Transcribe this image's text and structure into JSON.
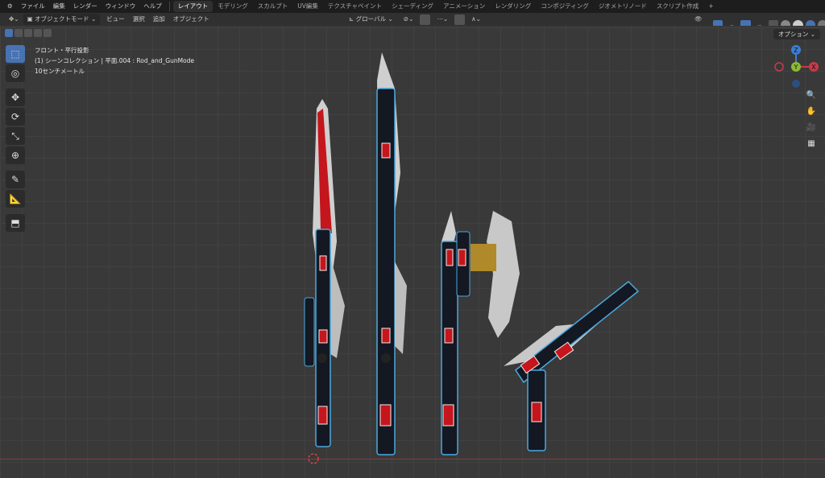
{
  "topbar": {
    "menus": [
      "ファイル",
      "編集",
      "レンダー",
      "ウィンドウ",
      "ヘルプ"
    ],
    "workspaces": [
      "レイアウト",
      "モデリング",
      "スカルプト",
      "UV編集",
      "テクスチャペイント",
      "シェーディング",
      "アニメーション",
      "レンダリング",
      "コンポジティング",
      "ジオメトリノード",
      "スクリプト作成"
    ],
    "active_workspace": "レイアウト",
    "add_tab": "+"
  },
  "header": {
    "mode": "オブジェクトモード",
    "menus": [
      "ビュー",
      "選択",
      "追加",
      "オブジェクト"
    ],
    "transform_orientation": "グローバル"
  },
  "viewport": {
    "view_name": "フロント・平行投影",
    "collection_info": "(1) シーンコレクション | 平面.004 : Rod_and_GunMode",
    "scale": "10センチメートル",
    "options_label": "オプション"
  },
  "gizmo": {
    "z": "Z",
    "y": "Y",
    "x": "X"
  },
  "colors": {
    "accent": "#4772b3",
    "x_axis": "#c53b4a",
    "y_axis": "#8bbb32",
    "z_axis": "#3d7ed6"
  }
}
